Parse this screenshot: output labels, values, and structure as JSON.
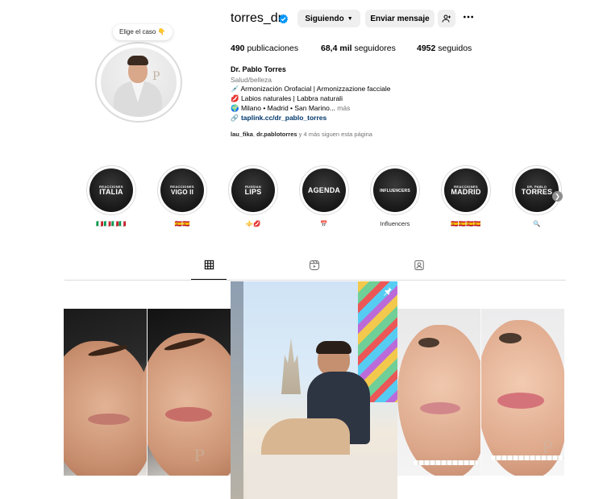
{
  "profile": {
    "username": "torres_dr",
    "verified": true,
    "note": "Elige el caso 👇",
    "buttons": {
      "following": "Siguiendo",
      "message": "Enviar mensaje"
    },
    "stats": {
      "posts_count": "490",
      "posts_label": "publicaciones",
      "followers_count": "68,4 mil",
      "followers_label": "seguidores",
      "following_count": "4952",
      "following_label": "seguidos"
    },
    "bio": {
      "name": "Dr. Pablo Torres",
      "category": "Salud/belleza",
      "line1": "💉 Armonización Orofacial | Armonizzazione facciale",
      "line2": "💋 Labios naturales | Labbra naturali",
      "line3": "🌍 Milano • Madrid • San Marino...",
      "more": "más",
      "link": "taplink.cc/dr_pablo_torres"
    },
    "followed_by": {
      "user1": "lau_fika",
      "user2": "dr.pablotorres",
      "rest": "y 4 más siguen esta página"
    }
  },
  "highlights": [
    {
      "top": "REACCIONES",
      "main": "ITALIA",
      "label": "🇮🇹🇮🇹🇮🇹🇮🇹"
    },
    {
      "top": "REACCIONES",
      "main": "VIGO II",
      "label": "🇪🇸🇪🇸"
    },
    {
      "top": "RUSSIAN",
      "main": "LIPS",
      "label": "⚜️💋"
    },
    {
      "top": "",
      "main": "AGENDA",
      "label": "📅"
    },
    {
      "top": "",
      "main": "INFLUENCERS",
      "label": "Influencers"
    },
    {
      "top": "REACCIONES",
      "main": "MADRID",
      "label": "🇪🇸🇪🇸🇪🇸🇪🇸"
    },
    {
      "top": "DR. PABLO",
      "main": "TORRES",
      "label": "🔍"
    }
  ],
  "tabs": [
    {
      "name": "posts",
      "icon": "grid-icon",
      "active": true
    },
    {
      "name": "reels",
      "icon": "reels-icon",
      "active": false
    },
    {
      "name": "tagged",
      "icon": "tagged-icon",
      "active": false
    }
  ],
  "colors": {
    "link": "#00376b",
    "verified": "#0095f6",
    "button_bg": "#efefef",
    "muted": "#737373"
  }
}
